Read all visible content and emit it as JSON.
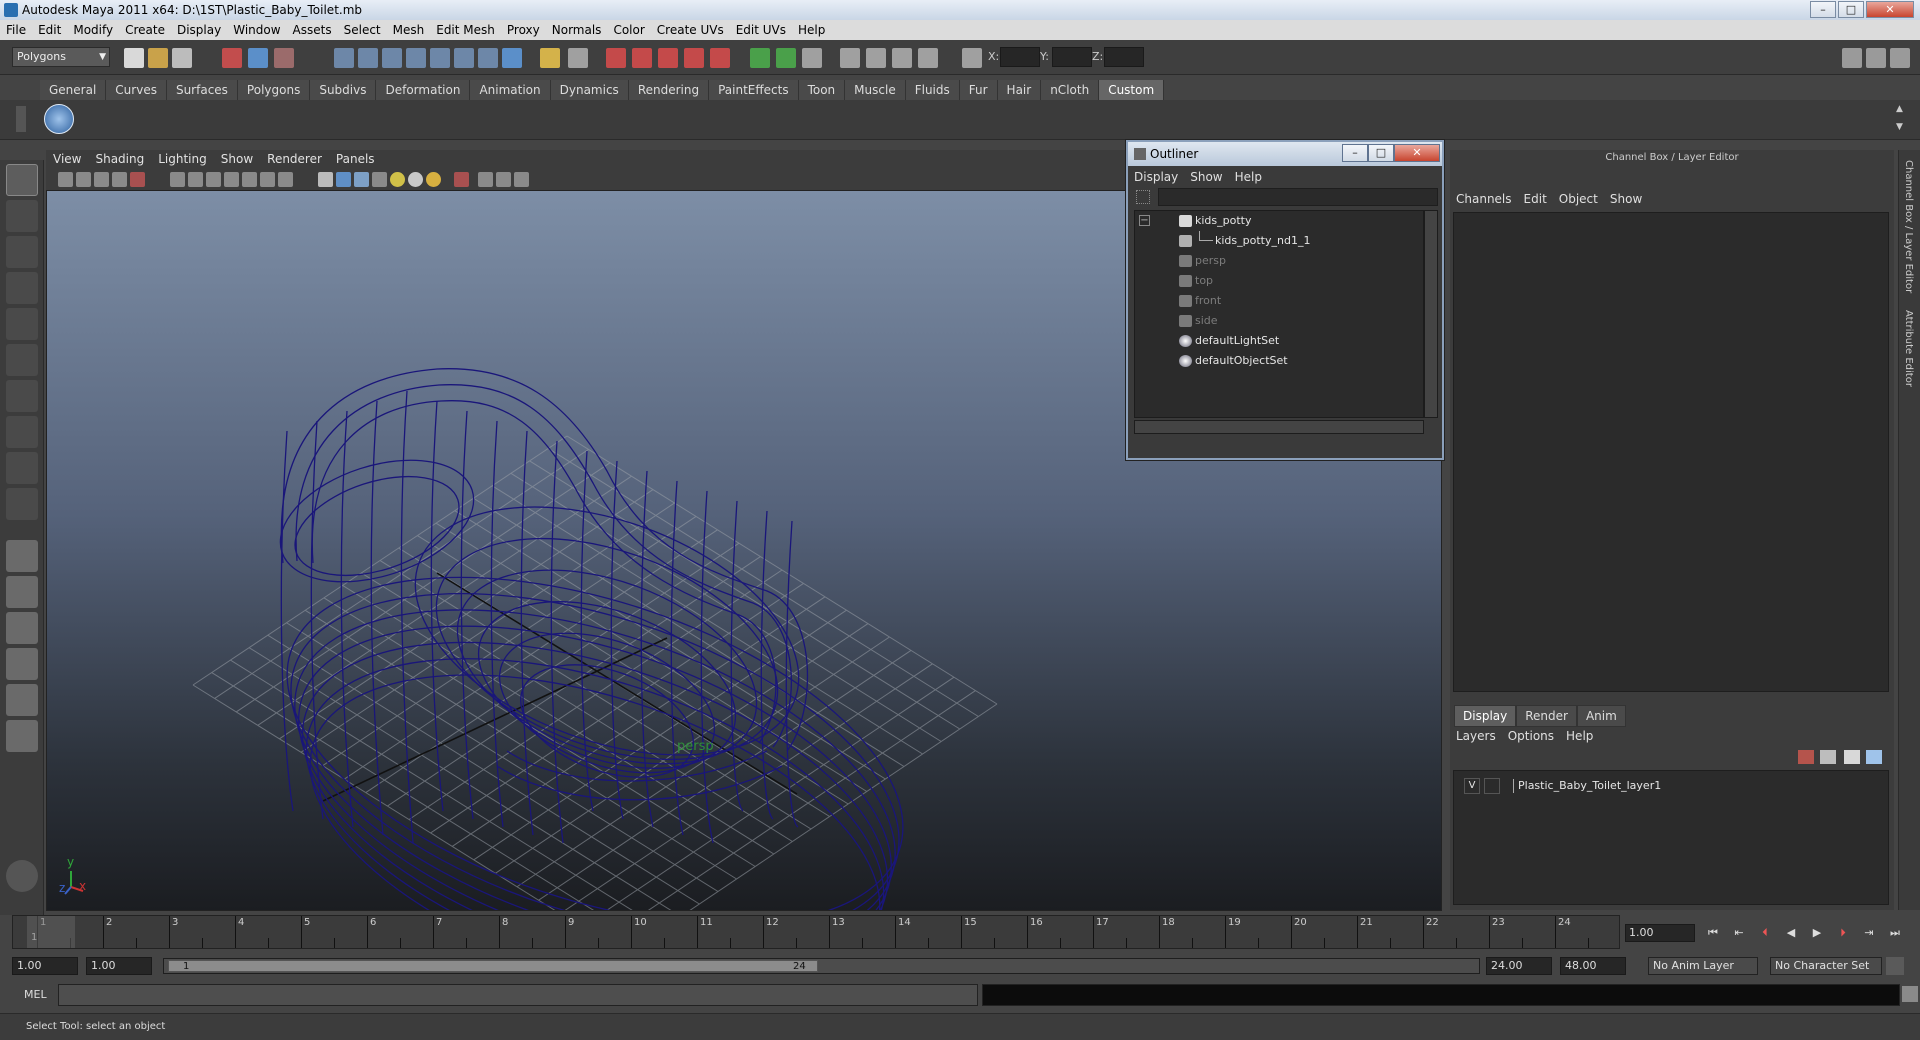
{
  "window": {
    "title": "Autodesk Maya 2011 x64: D:\\1ST\\Plastic_Baby_Toilet.mb",
    "min": "–",
    "max": "□",
    "close": "✕"
  },
  "menubar": [
    "File",
    "Edit",
    "Modify",
    "Create",
    "Display",
    "Window",
    "Assets",
    "Select",
    "Mesh",
    "Edit Mesh",
    "Proxy",
    "Normals",
    "Color",
    "Create UVs",
    "Edit UVs",
    "Help"
  ],
  "statusline": {
    "mode": "Polygons",
    "x_label": "X:",
    "y_label": "Y:",
    "z_label": "Z:"
  },
  "shelf_tabs": [
    "General",
    "Curves",
    "Surfaces",
    "Polygons",
    "Subdivs",
    "Deformation",
    "Animation",
    "Dynamics",
    "Rendering",
    "PaintEffects",
    "Toon",
    "Muscle",
    "Fluids",
    "Fur",
    "Hair",
    "nCloth",
    "Custom"
  ],
  "shelf_active": "Custom",
  "viewport": {
    "menu": [
      "View",
      "Shading",
      "Lighting",
      "Show",
      "Renderer",
      "Panels"
    ],
    "camera": "persp",
    "axis_y": "y",
    "axis_x": "x",
    "axis_z": "z"
  },
  "outliner": {
    "title": "Outliner",
    "menu": [
      "Display",
      "Show",
      "Help"
    ],
    "items": [
      {
        "label": "kids_potty",
        "dim": false,
        "icon": "mesh-icon"
      },
      {
        "label": "kids_potty_nd1_1",
        "dim": false,
        "icon": "nurbs-icon"
      },
      {
        "label": "persp",
        "dim": true,
        "icon": "camera-icon"
      },
      {
        "label": "top",
        "dim": true,
        "icon": "camera-icon"
      },
      {
        "label": "front",
        "dim": true,
        "icon": "camera-icon"
      },
      {
        "label": "side",
        "dim": true,
        "icon": "camera-icon"
      },
      {
        "label": "defaultLightSet",
        "dim": false,
        "icon": "set-icon"
      },
      {
        "label": "defaultObjectSet",
        "dim": false,
        "icon": "set-icon"
      }
    ]
  },
  "channelbox": {
    "title": "Channel Box / Layer Editor",
    "menu": [
      "Channels",
      "Edit",
      "Object",
      "Show"
    ],
    "layer_tabs": [
      "Display",
      "Render",
      "Anim"
    ],
    "layer_menu": [
      "Layers",
      "Options",
      "Help"
    ],
    "layer": {
      "visible": "V",
      "name": "Plastic_Baby_Toilet_layer1"
    }
  },
  "side_strip": {
    "label1": "Channel Box / Layer Editor",
    "label2": "Attribute Editor"
  },
  "timeline": {
    "ticks": [
      "1",
      "2",
      "3",
      "4",
      "5",
      "6",
      "7",
      "8",
      "9",
      "10",
      "11",
      "12",
      "13",
      "14",
      "15",
      "16",
      "17",
      "18",
      "19",
      "20",
      "21",
      "22",
      "23",
      "24"
    ],
    "current_marker": "1",
    "current_frame": "1.00"
  },
  "range": {
    "start": "1.00",
    "playback_start": "1.00",
    "thumb_start": "1",
    "thumb_end": "24",
    "playback_end": "24.00",
    "end": "48.00",
    "anim_layer": "No Anim Layer",
    "char_set": "No Character Set"
  },
  "cmdline": {
    "label": "MEL"
  },
  "helpline": "Select Tool: select an object"
}
